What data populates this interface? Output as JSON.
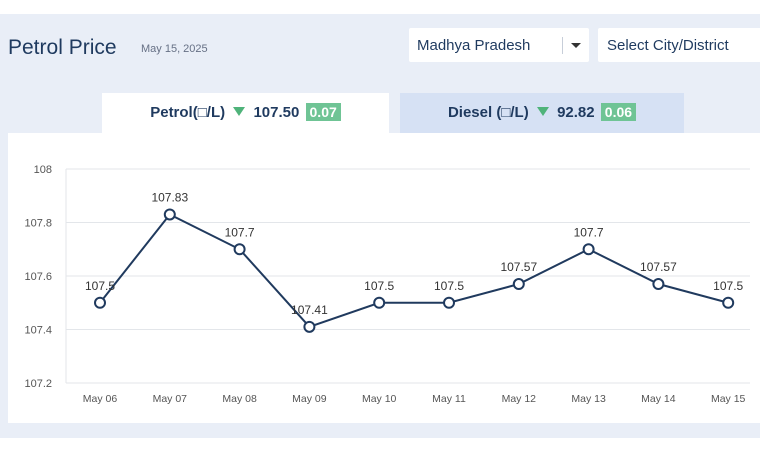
{
  "header": {
    "title": "Petrol Price",
    "date": "May 15, 2025",
    "state_select": "Madhya Pradesh",
    "city_select": "Select City/District"
  },
  "tabs": {
    "petrol": {
      "label": "Petrol(□/L)",
      "price": "107.50",
      "change": "0.07"
    },
    "diesel": {
      "label": "Diesel (□/L)",
      "price": "92.82",
      "change": "0.06"
    }
  },
  "colors": {
    "line": "#203a5e",
    "badge": "#6fc495",
    "down_arrow": "#4fb37a"
  },
  "chart_data": {
    "type": "line",
    "categories": [
      "May 06",
      "May 07",
      "May 08",
      "May 09",
      "May 10",
      "May 11",
      "May 12",
      "May 13",
      "May 14",
      "May 15"
    ],
    "values": [
      107.5,
      107.83,
      107.7,
      107.41,
      107.5,
      107.5,
      107.57,
      107.7,
      107.57,
      107.5
    ],
    "labels": [
      "107.5",
      "107.83",
      "107.7",
      "107.41",
      "107.5",
      "107.5",
      "107.57",
      "107.7",
      "107.57",
      "107.5"
    ],
    "yticks": [
      "108",
      "107.8",
      "107.6",
      "107.4",
      "107.2"
    ],
    "ylim": [
      107.2,
      108.0
    ],
    "grid": true
  }
}
